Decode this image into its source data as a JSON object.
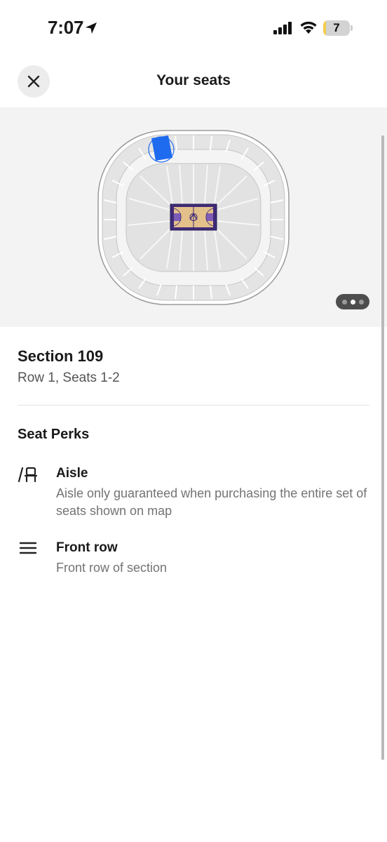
{
  "status_bar": {
    "time": "7:07",
    "battery_level": "7",
    "battery_fraction": 0.07
  },
  "header": {
    "title": "Your seats",
    "close_icon": "close-icon"
  },
  "map": {
    "selected_section": "109",
    "highlight_color": "#1f6bef",
    "court_color": "#3f2a78",
    "pager": {
      "pages": 3,
      "active_index": 1
    }
  },
  "seat_info": {
    "section": "Section 109",
    "detail": "Row 1, Seats 1-2"
  },
  "perks": {
    "heading": "Seat Perks",
    "items": [
      {
        "icon": "aisle-seat-icon",
        "title": "Aisle",
        "description": "Aisle only guaranteed when purchasing the entire set of seats shown on map"
      },
      {
        "icon": "front-row-icon",
        "title": "Front row",
        "description": "Front row of section"
      }
    ]
  }
}
